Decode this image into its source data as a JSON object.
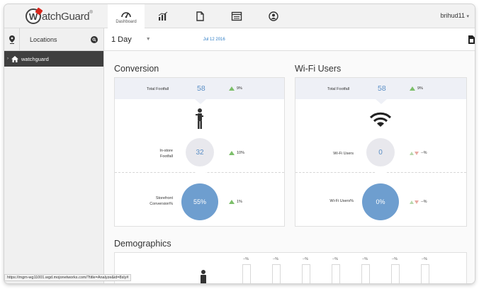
{
  "brand": {
    "logo_letter": "W",
    "logo_text": "atchGuard",
    "tm": "®",
    "accent": "#d8261c"
  },
  "nav": {
    "dashboard_label": "Dashboard",
    "items": [
      "dashboard-icon",
      "analytics-icon",
      "reports-icon",
      "monitor-icon",
      "user-circle-icon"
    ]
  },
  "user": {
    "name": "brihud11",
    "caret": "▾"
  },
  "sidebar": {
    "locations_label": "Locations",
    "tree": [
      {
        "label": "watchguard",
        "arrow": "›"
      }
    ]
  },
  "timebar": {
    "period": "1 Day",
    "period_caret": "▼",
    "date": "Jul 12 2016"
  },
  "conversion": {
    "title": "Conversion",
    "total_footfall_label": "Total Footfall",
    "total_footfall_value": "58",
    "total_footfall_change": "9%",
    "instore_label_line1": "In-store",
    "instore_label_line2": "Footfall",
    "instore_value": "32",
    "instore_change": "10%",
    "storefront_label_line1": "Storefront",
    "storefront_label_line2": "Conversion%",
    "storefront_value": "55%",
    "storefront_change": "1%"
  },
  "wifi": {
    "title": "Wi-Fi Users",
    "total_footfall_label": "Total Footfall",
    "total_footfall_value": "58",
    "total_footfall_change": "9%",
    "users_label": "Wi-Fi Users",
    "users_value": "0",
    "users_change": "--%",
    "users_pct_label": "Wi-Fi Users%",
    "users_pct_value": "0%",
    "users_pct_change": "--%"
  },
  "demographics": {
    "title": "Demographics",
    "bar_labels": [
      "--%",
      "--%",
      "--%",
      "--%",
      "--%",
      "--%",
      "--%"
    ]
  },
  "status_url": "https://mgm-wg11001.wgd.mojonetworks.com/?title=Analyze&id=8sly#"
}
